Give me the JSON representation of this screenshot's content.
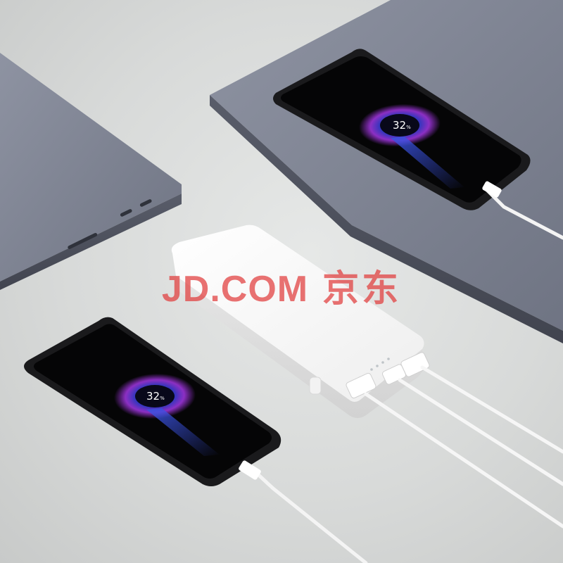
{
  "watermark": {
    "latin": "JD.COM",
    "chinese": "京东"
  },
  "phones": [
    {
      "id": "phone-top",
      "battery_level": "32",
      "battery_unit": "%"
    },
    {
      "id": "phone-bottom",
      "battery_level": "32",
      "battery_unit": "%"
    }
  ],
  "colors": {
    "background": "#d8dad9",
    "laptop": "#7b7f8e",
    "power_bank": "#f6f6f6",
    "charge_ring_inner": "#3a4fd8",
    "charge_ring_outer": "#a13bd6",
    "watermark": "#e13c3c"
  }
}
